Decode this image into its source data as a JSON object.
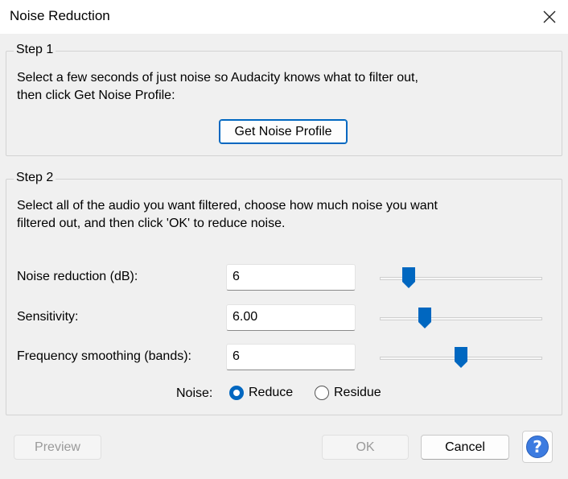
{
  "window": {
    "title": "Noise Reduction"
  },
  "step1": {
    "legend": "Step 1",
    "line1": "Select a few seconds of just noise so Audacity knows what to filter out,",
    "line2": "then click Get Noise Profile:",
    "button": "Get Noise Profile"
  },
  "step2": {
    "legend": "Step 2",
    "line1": "Select all of the audio you want filtered, choose how much noise you want",
    "line2": "filtered out, and then click 'OK' to reduce noise.",
    "params": [
      {
        "label": "Noise reduction (dB):",
        "value": "6",
        "slider_fraction": 0.15
      },
      {
        "label": "Sensitivity:",
        "value": "6.00",
        "slider_fraction": 0.26
      },
      {
        "label": "Frequency smoothing (bands):",
        "value": "6",
        "slider_fraction": 0.5
      }
    ],
    "noise_label": "Noise:",
    "noise_options": [
      {
        "label": "Reduce",
        "selected": true
      },
      {
        "label": "Residue",
        "selected": false
      }
    ]
  },
  "buttons": {
    "preview": "Preview",
    "ok": "OK",
    "cancel": "Cancel",
    "help": "?"
  },
  "colors": {
    "accent": "#0067c0",
    "slider_thumb": "#0067c0",
    "help_icon": "#3c7be0"
  }
}
